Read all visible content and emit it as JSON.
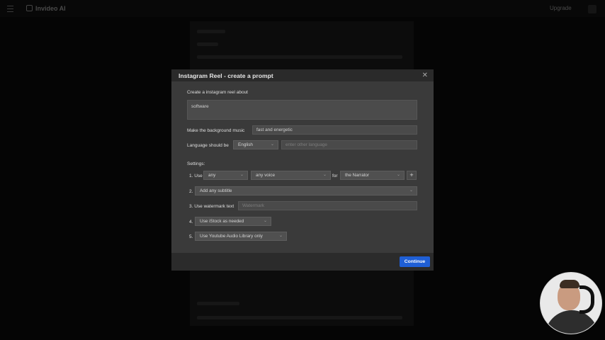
{
  "app": {
    "name": "Invideo AI",
    "upgrade_label": "Upgrade"
  },
  "modal": {
    "title": "Instagram Reel - create a prompt",
    "prompt_label": "Create a instagram reel about",
    "prompt_value": "software",
    "music_label": "Make the background music",
    "music_value": "fast and energetic",
    "language_label": "Language should be",
    "language_value": "English",
    "other_language_placeholder": "enter other language",
    "settings_label": "Settings:",
    "setting1": {
      "prefix": "1. Use",
      "option_a": "any",
      "option_b": "any voice",
      "for_label": "for",
      "option_c": "the Narrator",
      "add_label": "+"
    },
    "setting2": {
      "num": "2.",
      "value": "Add any subtitle"
    },
    "setting3": {
      "label": "3. Use watermark text",
      "placeholder": "Watermark"
    },
    "setting4": {
      "num": "4.",
      "value": "Use iStock as needed"
    },
    "setting5": {
      "num": "5.",
      "value": "Use Youtube Audio Library only"
    },
    "continue_label": "Continue"
  },
  "icons": {
    "close": "close-icon",
    "chevron": "chevron-down-icon",
    "menu": "menu-icon",
    "plus": "plus-icon"
  }
}
